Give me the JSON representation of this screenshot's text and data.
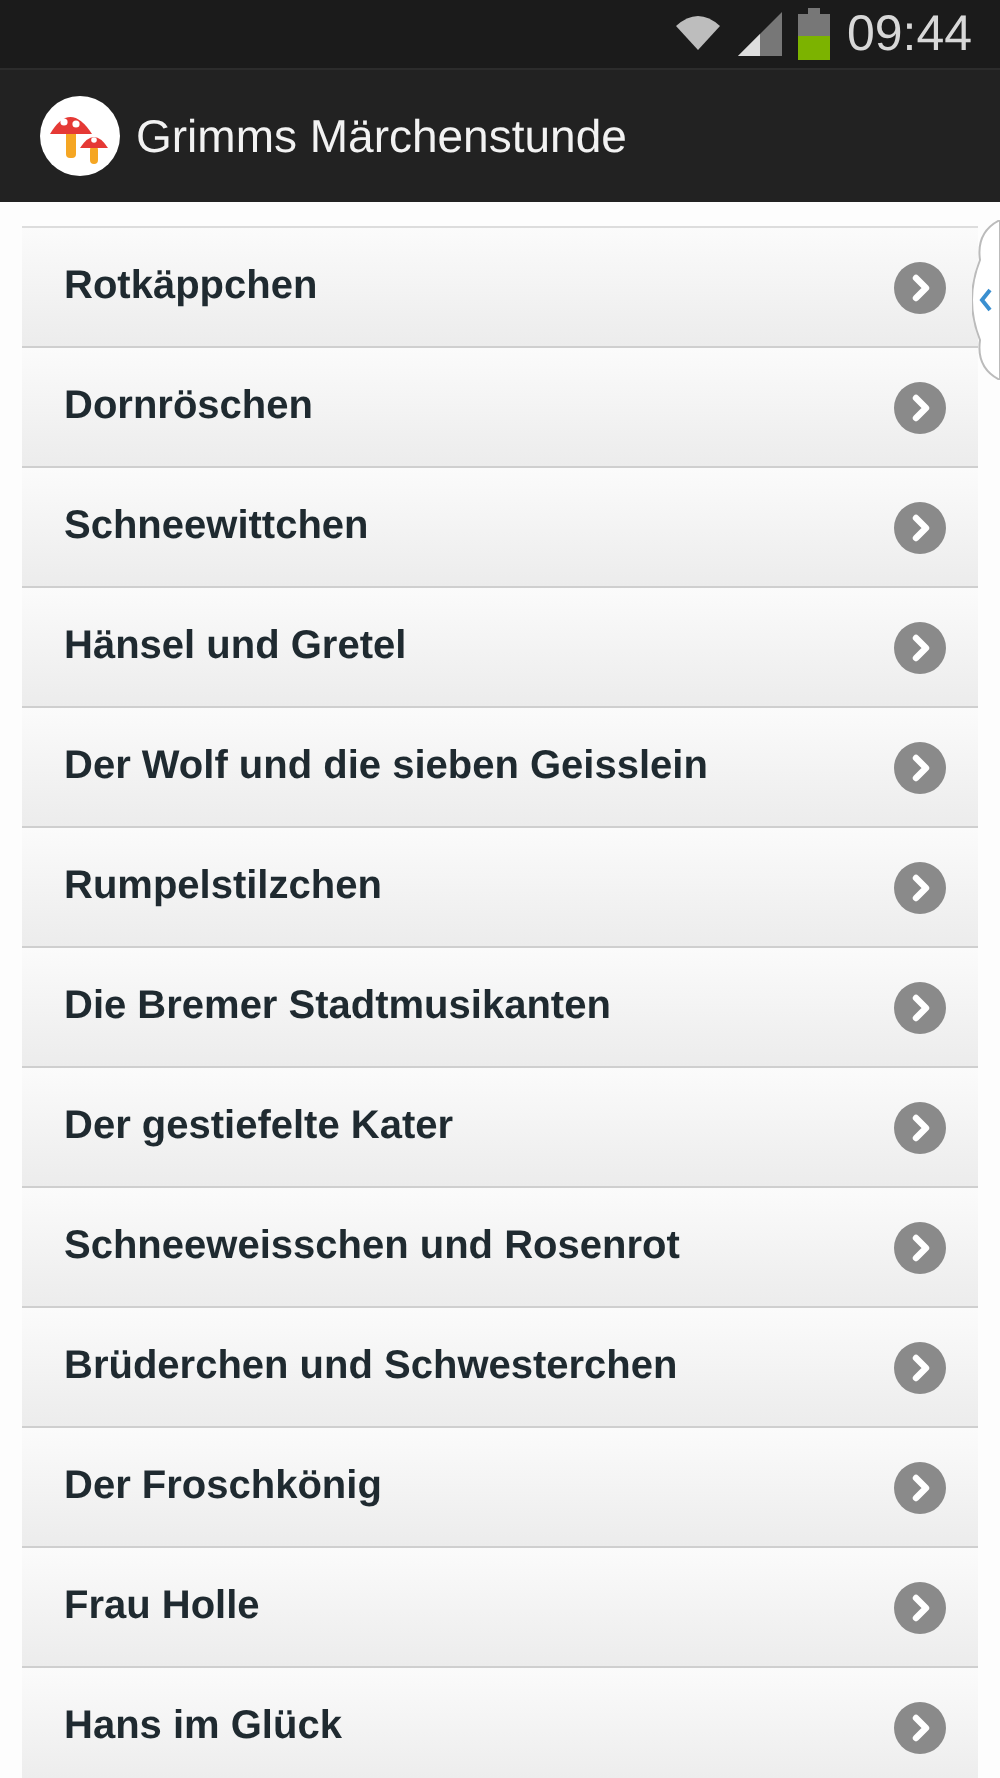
{
  "status_bar": {
    "time": "09:44"
  },
  "app_bar": {
    "title": "Grimms Märchenstunde"
  },
  "stories": [
    {
      "title": "Rotkäppchen"
    },
    {
      "title": "Dornröschen"
    },
    {
      "title": "Schneewittchen"
    },
    {
      "title": "Hänsel und Gretel"
    },
    {
      "title": "Der Wolf und die sieben Geisslein"
    },
    {
      "title": "Rumpelstilzchen"
    },
    {
      "title": "Die Bremer Stadtmusikanten"
    },
    {
      "title": "Der gestiefelte Kater"
    },
    {
      "title": "Schneeweisschen und Rosenrot"
    },
    {
      "title": "Brüderchen und Schwesterchen"
    },
    {
      "title": "Der Froschkönig"
    },
    {
      "title": "Frau Holle"
    },
    {
      "title": "Hans im Glück"
    }
  ]
}
